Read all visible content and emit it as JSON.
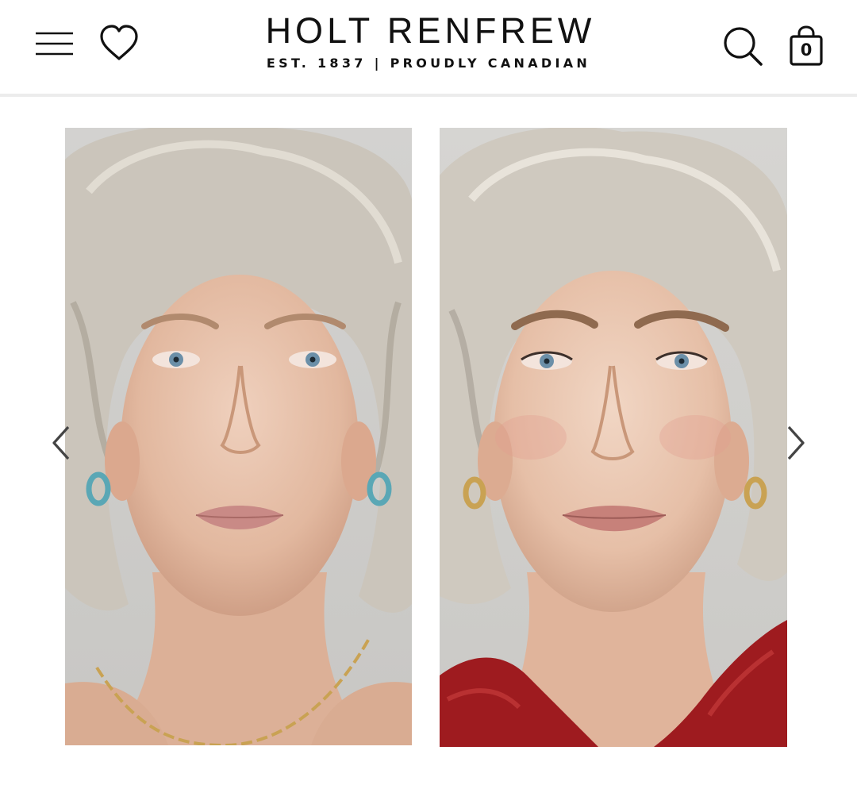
{
  "header": {
    "menu_icon": "hamburger-menu-icon",
    "wishlist_icon": "heart-icon",
    "brand": {
      "name": "HOLT RENFREW",
      "tagline": "EST. 1837 | PROUDLY CANADIAN"
    },
    "search_icon": "search-icon",
    "bag_icon": "shopping-bag-icon",
    "bag_count": "0"
  },
  "carousel": {
    "prev_icon": "chevron-left-icon",
    "next_icon": "chevron-right-icon",
    "slides": [
      {
        "image": "portrait photo, no makeup"
      },
      {
        "image": "portrait photo, with makeup"
      }
    ]
  },
  "colors": {
    "text": "#111111",
    "divider": "#ececec",
    "photo_background": "#d6d6d4",
    "skin": "#e8c4ae",
    "hair": "#c9c4bb",
    "dress": "#9e1b1f",
    "gold": "#c9a253"
  }
}
